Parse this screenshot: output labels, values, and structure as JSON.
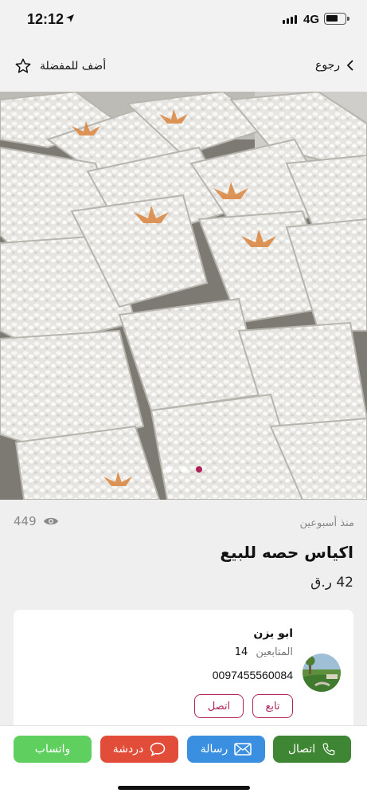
{
  "status_bar": {
    "time": "12:12",
    "network": "4G"
  },
  "header": {
    "back_label": "رجوع",
    "favorite_label": "أضف للمفضلة"
  },
  "gallery": {
    "image_count": 3,
    "active_index": 2
  },
  "listing": {
    "time_ago": "منذ أسبوعين",
    "views": "449",
    "title": "اكياس حصه للبيع",
    "price": "42 ر.ق"
  },
  "seller": {
    "name": "ابو يزن",
    "followers_label": "المتابعين",
    "followers_count": "14",
    "phone": "0097455560084",
    "follow_label": "تابع",
    "call_label": "اتصل"
  },
  "actions": {
    "call": "اتصال",
    "message": "رسالة",
    "chat": "دردشة",
    "whatsapp": "واتساب"
  },
  "colors": {
    "accent": "#b0235a",
    "call": "#3e8633",
    "message": "#3b8fe0",
    "chat": "#e24d39",
    "whatsapp": "#5fcf5f"
  }
}
